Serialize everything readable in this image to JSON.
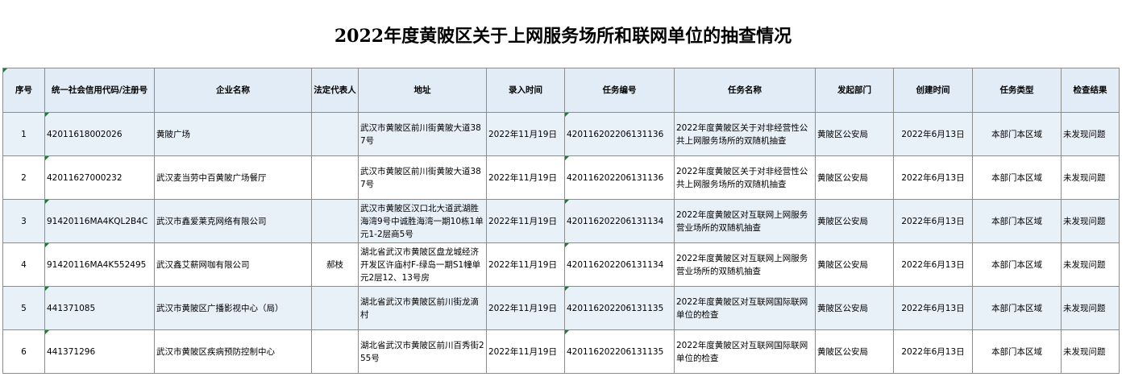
{
  "page": {
    "title": "2022年度黄陂区关于上网服务场所和联网单位的抽查情况"
  },
  "table": {
    "headers": [
      "序号",
      "统一社会信用代码/注册号",
      "企业名称",
      "法定代表人",
      "地址",
      "录入时间",
      "任务编号",
      "任务名称",
      "发起部门",
      "创建时间",
      "任务类型",
      "检查结果"
    ],
    "rows": [
      [
        "1",
        "42011618002026",
        "黄陂广场",
        "",
        "武汉市黄陂区前川街黄陂大道387号",
        "2022年11月19日",
        "420116202206131136",
        "2022年度黄陂区关于对非经营性公共上网服务场所的双随机抽查",
        "黄陂区公安局",
        "2022年6月13日",
        "本部门本区域",
        "未发现问题"
      ],
      [
        "2",
        "42011627000232",
        "武汉麦当劳中百黄陂广场餐厅",
        "",
        "武汉市黄陂区前川街黄陂大道387号",
        "2022年11月19日",
        "420116202206131136",
        "2022年度黄陂区关于对非经营性公共上网服务场所的双随机抽查",
        "黄陂区公安局",
        "2022年6月13日",
        "本部门本区域",
        "未发现问题"
      ],
      [
        "3",
        "91420116MA4KQL2B4C",
        "武汉市鑫爱莱克网络有限公司",
        "",
        "武汉市黄陂区汉口北大道武湖胜海湾9号中诚胜海湾一期10栋1单元1-2层商5号",
        "2022年11月19日",
        "420116202206131134",
        "2022年度黄陂区对互联网上网服务营业场所的双随机抽查",
        "黄陂区公安局",
        "2022年6月13日",
        "本部门本区域",
        "未发现问题"
      ],
      [
        "4",
        "91420116MA4K552495",
        "武汉鑫艾薪网咖有限公司",
        "郝枝",
        "湖北省武汉市黄陂区盘龙城经济开发区许庙村F-绿岛一期S1幢单元2层12、13号房",
        "2022年11月19日",
        "420116202206131134",
        "2022年度黄陂区对互联网上网服务营业场所的双随机抽查",
        "黄陂区公安局",
        "2022年6月13日",
        "本部门本区域",
        "未发现问题"
      ],
      [
        "5",
        "441371085",
        "武汉市黄陂区广播影视中心（局）",
        "",
        "湖北省武汉市黄陂区前川街龙滴村",
        "2022年11月19日",
        "420116202206131135",
        "2022年度黄陂区对互联网国际联网单位的检查",
        "黄陂区公安局",
        "2022年6月13日",
        "本部门本区域",
        "未发现问题"
      ],
      [
        "6",
        "441371296",
        "武汉市黄陂区疾病预防控制中心",
        "",
        "湖北省武汉市黄陂区前川百秀街255号",
        "2022年11月19日",
        "420116202206131135",
        "2022年度黄陂区对互联网国际联网单位的检查",
        "黄陂区公安局",
        "2022年6月13日",
        "本部门本区域",
        "未发现问题"
      ]
    ]
  }
}
